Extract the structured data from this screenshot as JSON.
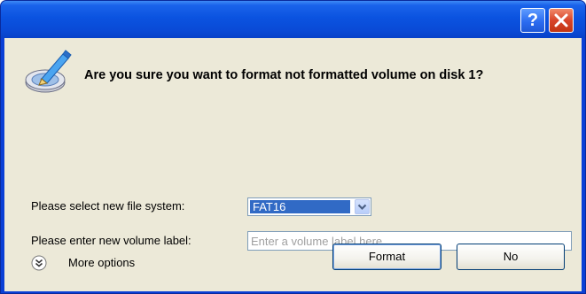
{
  "titlebar": {
    "help_icon": "?",
    "close_icon": "x"
  },
  "heading": {
    "icon": "disk-format-icon",
    "text": "Are you sure you want to format not formatted volume on disk 1?"
  },
  "file_system": {
    "label": "Please select new file system:",
    "selected": "FAT16"
  },
  "volume_label": {
    "label": "Please enter new volume label:",
    "value": "",
    "placeholder": "Enter a volume label here"
  },
  "more_options": {
    "label": "More options",
    "icon": "double-chevron-down-icon"
  },
  "buttons": {
    "format": "Format",
    "no": "No"
  },
  "colors": {
    "titlebar": "#0a4ad6",
    "client": "#ece9d8",
    "selection": "#316ac5",
    "close": "#d8452a"
  }
}
